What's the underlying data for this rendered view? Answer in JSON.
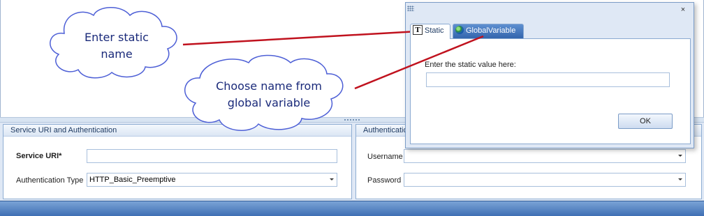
{
  "popup": {
    "close_glyph": "×",
    "tabs": [
      {
        "label": "Static",
        "icon": "text-t-icon"
      },
      {
        "label": "GlobalVariable",
        "icon": "globe-icon"
      }
    ],
    "static_prompt": "Enter the static value here:",
    "static_value": "",
    "ok_label": "OK"
  },
  "service_group": {
    "title": "Service URI and Authentication",
    "service_uri_label": "Service URI*",
    "service_uri_value": "",
    "auth_type_label": "Authentication Type",
    "auth_type_value": "HTTP_Basic_Preemptive"
  },
  "auth_group": {
    "title": "Authentication",
    "username_label": "Username",
    "username_value": "",
    "password_label": "Password",
    "password_value": ""
  },
  "callouts": {
    "static_line1": "Enter static",
    "static_line2": "name",
    "global_line1": "Choose name from",
    "global_line2": "global variable"
  },
  "colors": {
    "accent": "#3365ad",
    "panel_bg": "#dfe8f5",
    "callout_line": "#c0121e",
    "callout_fill": "#ffffff",
    "callout_stroke": "#4d5fd6"
  }
}
